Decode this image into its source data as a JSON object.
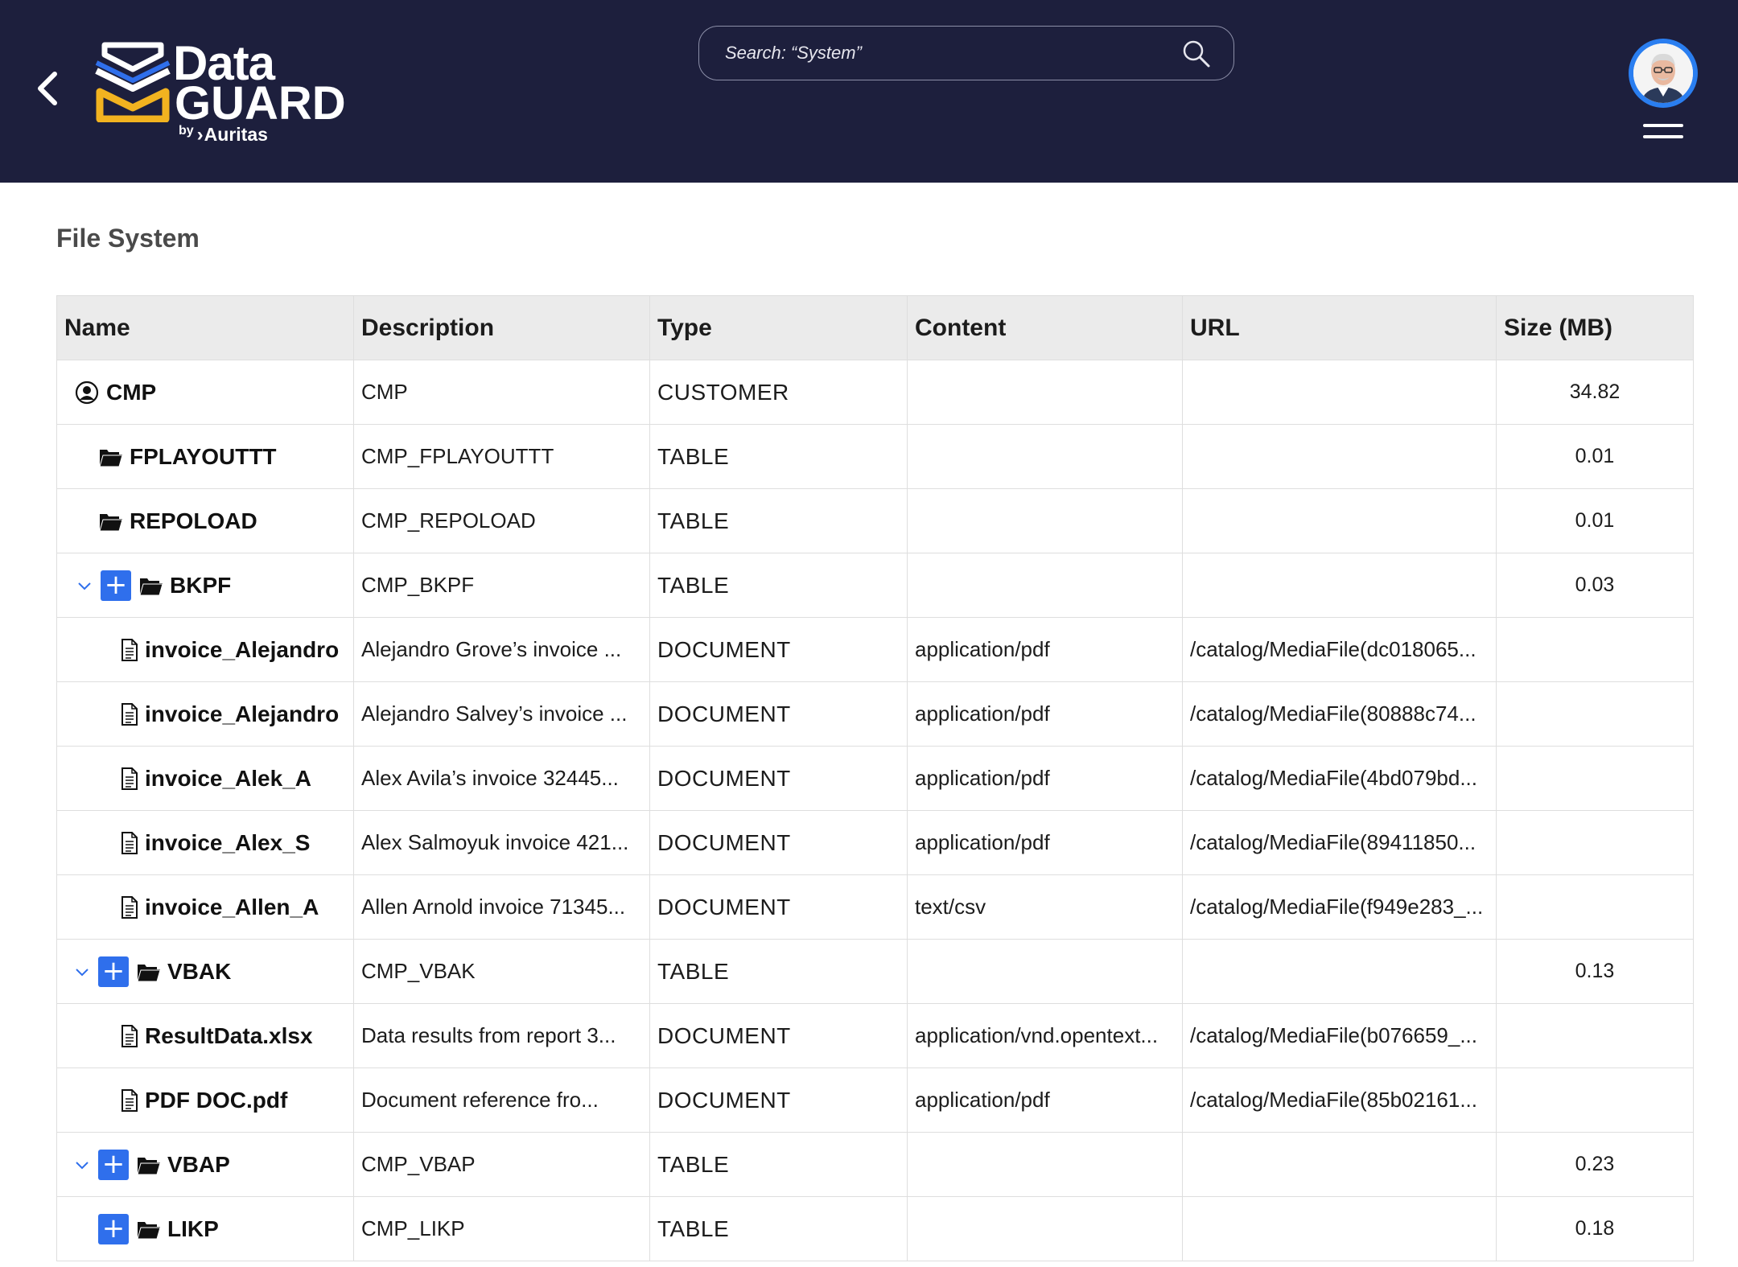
{
  "header": {
    "logo": {
      "line1": "Data",
      "line2": "GUARD",
      "by": "by",
      "brand": "Auritas"
    },
    "search": {
      "placeholder": "Search: “System”"
    },
    "colors": {
      "background": "#1d1f3d",
      "accent_blue": "#2f6fec",
      "logo_yellow": "#f2b320"
    }
  },
  "page": {
    "title": "File System"
  },
  "table": {
    "columns": [
      "Name",
      "Description",
      "Type",
      "Content",
      "URL",
      "Size (MB)"
    ],
    "rows": [
      {
        "name": "CMP",
        "description": "CMP",
        "type": "CUSTOMER",
        "content": "",
        "url": "",
        "size": "34.82",
        "icon": "customer-icon"
      },
      {
        "name": "FPLAYOUTTT",
        "description": "CMP_FPLAYOUTTT",
        "type": "TABLE",
        "content": "",
        "url": "",
        "size": "0.01",
        "icon": "folder-icon"
      },
      {
        "name": "REPOLOAD",
        "description": "CMP_REPOLOAD",
        "type": "TABLE",
        "content": "",
        "url": "",
        "size": "0.01",
        "icon": "folder-icon"
      },
      {
        "name": "BKPF",
        "description": "CMP_BKPF",
        "type": "TABLE",
        "content": "",
        "url": "",
        "size": "0.03",
        "icon": "folder-icon"
      },
      {
        "name": "invoice_Alejandro",
        "description": "Alejandro Grove’s invoice ...",
        "type": "DOCUMENT",
        "content": "application/pdf",
        "url": "/catalog/MediaFile(dc018065...",
        "size": "",
        "icon": "document-icon"
      },
      {
        "name": "invoice_Alejandro",
        "description": "Alejandro Salvey’s invoice ...",
        "type": "DOCUMENT",
        "content": "application/pdf",
        "url": "/catalog/MediaFile(80888c74...",
        "size": "",
        "icon": "document-icon"
      },
      {
        "name": "invoice_Alek_A",
        "description": "Alex Avila’s invoice 32445...",
        "type": "DOCUMENT",
        "content": "application/pdf",
        "url": "/catalog/MediaFile(4bd079bd...",
        "size": "",
        "icon": "document-icon"
      },
      {
        "name": "invoice_Alex_S",
        "description": "Alex Salmoyuk invoice 421...",
        "type": "DOCUMENT",
        "content": "application/pdf",
        "url": "/catalog/MediaFile(89411850...",
        "size": "",
        "icon": "document-icon"
      },
      {
        "name": "invoice_Allen_A",
        "description": "Allen Arnold invoice 71345...",
        "type": "DOCUMENT",
        "content": "text/csv",
        "url": "/catalog/MediaFile(f949e283_...",
        "size": "",
        "icon": "document-icon"
      },
      {
        "name": "VBAK",
        "description": "CMP_VBAK",
        "type": "TABLE",
        "content": "",
        "url": "",
        "size": "0.13",
        "icon": "folder-icon"
      },
      {
        "name": "ResultData.xlsx",
        "description": "Data results from report 3...",
        "type": "DOCUMENT",
        "content": "application/vnd.opentext...",
        "url": "/catalog/MediaFile(b076659_...",
        "size": "",
        "icon": "document-icon"
      },
      {
        "name": "PDF DOC.pdf",
        "description": "Document reference fro...",
        "type": "DOCUMENT",
        "content": "application/pdf",
        "url": "/catalog/MediaFile(85b02161...",
        "size": "",
        "icon": "document-icon"
      },
      {
        "name": "VBAP",
        "description": "CMP_VBAP",
        "type": "TABLE",
        "content": "",
        "url": "",
        "size": "0.23",
        "icon": "folder-icon"
      },
      {
        "name": "LIKP",
        "description": "CMP_LIKP",
        "type": "TABLE",
        "content": "",
        "url": "",
        "size": "0.18",
        "icon": "folder-icon"
      }
    ]
  }
}
